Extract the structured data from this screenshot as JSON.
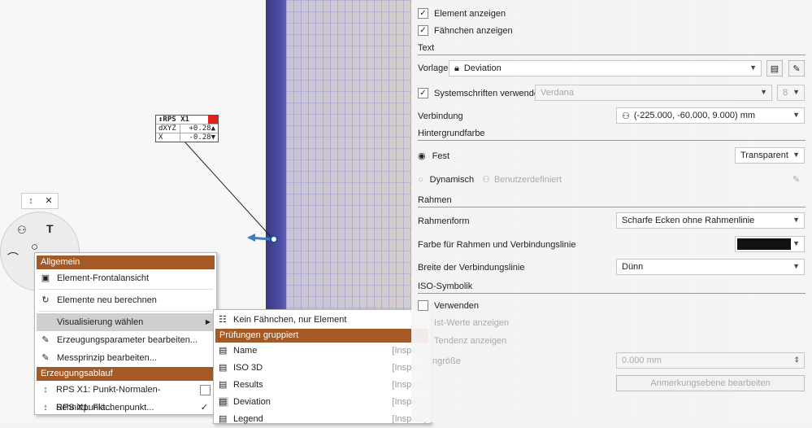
{
  "panel": {
    "show_element": "Element anzeigen",
    "show_flags": "Fähnchen anzeigen",
    "sec_text": "Text",
    "template_label": "Vorlage",
    "template_value": "Deviation",
    "system_fonts": "Systemschriften verwenden",
    "font_name": "Verdana",
    "font_size": "8",
    "connection_label": "Verbindung",
    "connection_value": "(-225.000, -60.000, 9.000) mm",
    "sec_background": "Hintergrundfarbe",
    "fixed": "Fest",
    "fixed_value": "Transparent",
    "dynamic": "Dynamisch",
    "dynamic_value": "Benutzerdefiniert",
    "sec_frame": "Rahmen",
    "frame_shape_label": "Rahmenform",
    "frame_shape_value": "Scharfe Ecken ohne Rahmenlinie",
    "frame_color_label": "Farbe für Rahmen und Verbindungslinie",
    "line_width_label": "Breite der Verbindungslinie",
    "line_width_value": "Dünn",
    "sec_iso": "ISO-Symbolik",
    "use": "Verwenden",
    "actual_values": "Ist-Werte anzeigen",
    "trend": "Tendenz anzeigen",
    "size_label": "ngröße",
    "size_value": "0.000 mm",
    "annotation_btn": "Anmerkungsebene bearbeiten"
  },
  "flag": {
    "title": "↕RPS X1",
    "r1k": "dXYZ",
    "r1v": "+0.28▲",
    "r2k": "X",
    "r2v": "-0.28▼"
  },
  "menu": {
    "h1": "Allgemein",
    "front": "Element-Frontalansicht",
    "recalc": "Elemente neu berechnen",
    "vis": "Visualisierung wählen",
    "edit_params": "Erzeugungsparameter bearbeiten...",
    "edit_measure": "Messprinzip bearbeiten...",
    "h2": "Erzeugungsablauf",
    "rps1": "RPS X1: Punkt-Normalen-Schnittpunkt...",
    "rps2": "RPS X1: Flächenpunkt..."
  },
  "submenu": {
    "none": "Kein Fähnchen, nur Element",
    "h": "Prüfungen gruppiert",
    "items": [
      {
        "label": "Name",
        "tag": "[Inspect]"
      },
      {
        "label": "ISO 3D",
        "tag": "[Inspect]"
      },
      {
        "label": "Results",
        "tag": "[Inspect]"
      },
      {
        "label": "Deviation",
        "tag": "[Inspect]"
      },
      {
        "label": "Legend",
        "tag": "[Inspect]"
      }
    ]
  },
  "colors": {
    "accent": "#a35a26",
    "flag_red": "#e32020",
    "frame_color": "#111111"
  }
}
